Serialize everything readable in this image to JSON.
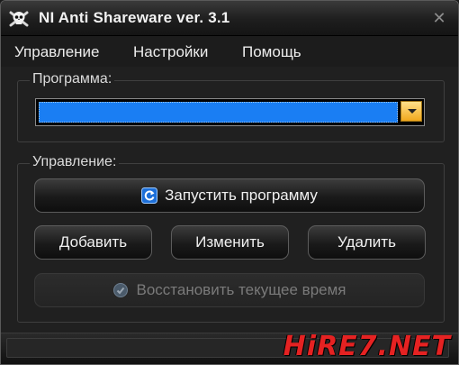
{
  "window": {
    "title": "NI Anti Shareware ver. 3.1",
    "close_glyph": "✕"
  },
  "menu": {
    "items": [
      "Управление",
      "Настройки",
      "Помощь"
    ]
  },
  "program_group": {
    "label": "Программа:",
    "selected_value": ""
  },
  "control_group": {
    "label": "Управление:",
    "launch_label": "Запустить программу",
    "add_label": "Добавить",
    "edit_label": "Изменить",
    "delete_label": "Удалить",
    "restore_label": "Восстановить текущее время",
    "restore_enabled": false
  },
  "watermark": {
    "text": "HiRE7.NET"
  },
  "colors": {
    "selection": "#1a7ef3",
    "dropdown_button": "#f1a81d",
    "watermark": "#e52222"
  },
  "icons": {
    "app": "skull-crossbones-icon",
    "launch": "launch-refresh-icon",
    "restore": "clock-restore-icon",
    "dropdown": "chevron-down-icon"
  }
}
